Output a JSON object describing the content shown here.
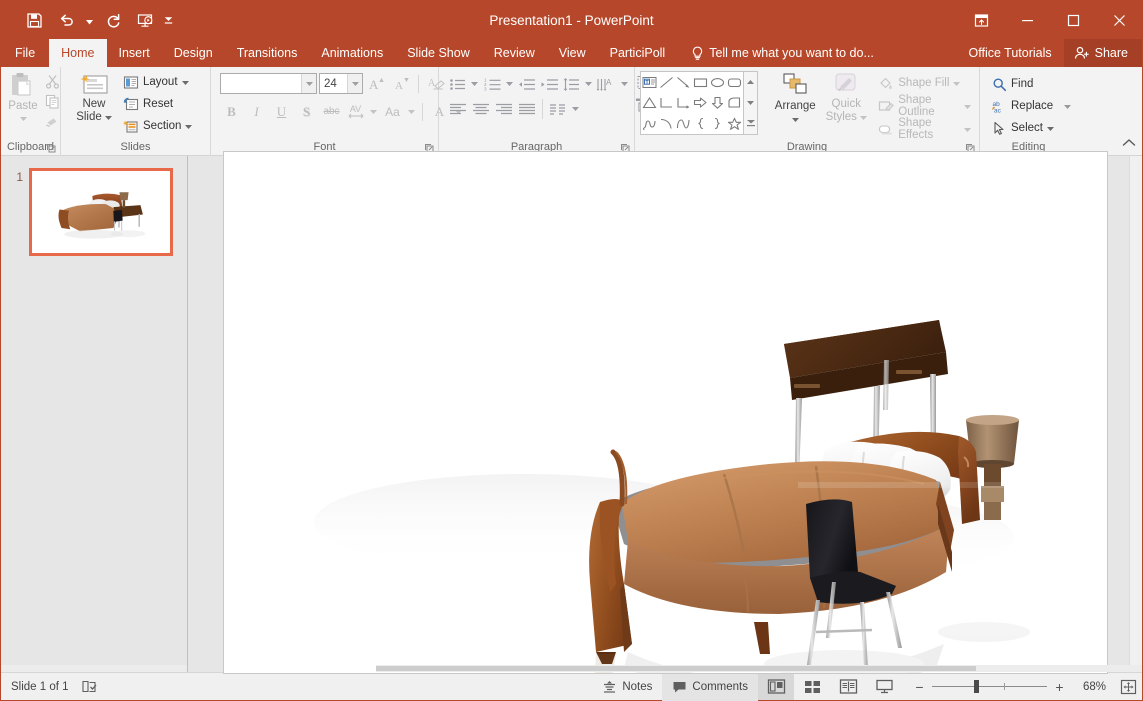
{
  "titlebar": {
    "title": "Presentation1 - PowerPoint",
    "quick_access": [
      {
        "name": "save-icon",
        "label": "Save"
      },
      {
        "name": "undo-icon",
        "label": "Undo"
      },
      {
        "name": "redo-icon",
        "label": "Redo"
      },
      {
        "name": "start-presentation-icon",
        "label": "Start From Beginning"
      },
      {
        "name": "customize-qat-icon",
        "label": "Customize Quick Access Toolbar"
      }
    ],
    "window_controls": [
      {
        "name": "ribbon-display-options",
        "label": "Ribbon Display Options"
      },
      {
        "name": "minimize",
        "label": "Minimize"
      },
      {
        "name": "maximize",
        "label": "Maximize"
      },
      {
        "name": "close",
        "label": "Close"
      }
    ]
  },
  "tabs": [
    {
      "label": "File",
      "active": false
    },
    {
      "label": "Home",
      "active": true
    },
    {
      "label": "Insert",
      "active": false
    },
    {
      "label": "Design",
      "active": false
    },
    {
      "label": "Transitions",
      "active": false
    },
    {
      "label": "Animations",
      "active": false
    },
    {
      "label": "Slide Show",
      "active": false
    },
    {
      "label": "Review",
      "active": false
    },
    {
      "label": "View",
      "active": false
    },
    {
      "label": "ParticiPoll",
      "active": false
    }
  ],
  "tellme": {
    "placeholder": "Tell me what you want to do..."
  },
  "account": {
    "tutorials": "Office Tutorials",
    "share": "Share"
  },
  "ribbon": {
    "clipboard": {
      "label": "Clipboard",
      "paste": "Paste",
      "cut": "Cut",
      "copy": "Copy",
      "format_painter": "Format Painter"
    },
    "slides": {
      "label": "Slides",
      "new_slide_line1": "New",
      "new_slide_line2": "Slide",
      "layout": "Layout",
      "reset": "Reset",
      "section": "Section"
    },
    "font": {
      "label": "Font",
      "font_name": "",
      "font_name_placeholder": "",
      "font_size": "24",
      "bold": "B",
      "italic": "I",
      "underline": "U",
      "shadow": "S",
      "strikethrough": "abc",
      "character_spacing": "AV",
      "change_case": "Aa",
      "font_color": "A",
      "increase_font": "A",
      "decrease_font": "A",
      "clear_formatting": "Clear All Formatting"
    },
    "paragraph": {
      "label": "Paragraph",
      "buttons": [
        "Bullets",
        "Numbering",
        "Decrease Indent",
        "Increase Indent",
        "Line Spacing",
        "Text Direction",
        "Align Text",
        "Align Left",
        "Center",
        "Align Right",
        "Justify",
        "Columns",
        "Convert to SmartArt"
      ]
    },
    "drawing": {
      "label": "Drawing",
      "arrange": "Arrange",
      "quick_styles_line1": "Quick",
      "quick_styles_line2": "Styles",
      "shape_fill": "Shape Fill",
      "shape_outline": "Shape Outline",
      "shape_effects": "Shape Effects",
      "shapes": [
        "text-box",
        "line",
        "arrow",
        "rectangle",
        "oval",
        "rounded-rectangle",
        "triangle",
        "elbow-connector",
        "elbow-arrow-connector",
        "right-arrow",
        "down-arrow",
        "flowchart-shape",
        "scribble",
        "arc",
        "wave",
        "left-brace",
        "right-brace",
        "star"
      ]
    },
    "editing": {
      "label": "Editing",
      "find": "Find",
      "replace": "Replace",
      "select": "Select"
    }
  },
  "thumbnails": [
    {
      "number": "1",
      "selected": true
    }
  ],
  "slide": {
    "alt": "3D rendered bedroom furniture set: sleigh bed with tan bedding, white pillows, wooden desk with chrome legs, black chair and table lamp"
  },
  "statusbar": {
    "slide_count": "Slide 1 of 1",
    "accessibility_icon": "accessibility-checker-icon",
    "notes": "Notes",
    "comments": "Comments",
    "views": [
      {
        "name": "normal-view",
        "label": "Normal",
        "active": true
      },
      {
        "name": "slide-sorter-view",
        "label": "Slide Sorter",
        "active": false
      },
      {
        "name": "reading-view",
        "label": "Reading View",
        "active": false
      },
      {
        "name": "slide-show-view",
        "label": "Slide Show",
        "active": false
      }
    ],
    "zoom_out": "−",
    "zoom_in": "+",
    "zoom_level": "68%",
    "fit_label": "Fit slide to current window"
  },
  "colors": {
    "accent": "#b7472a",
    "tab_active_bg": "#f3f3f3",
    "ribbon_bg": "#f3f3f3",
    "workspace_bg": "#e6e6e6",
    "thumb_selected_border": "#e8694a"
  }
}
